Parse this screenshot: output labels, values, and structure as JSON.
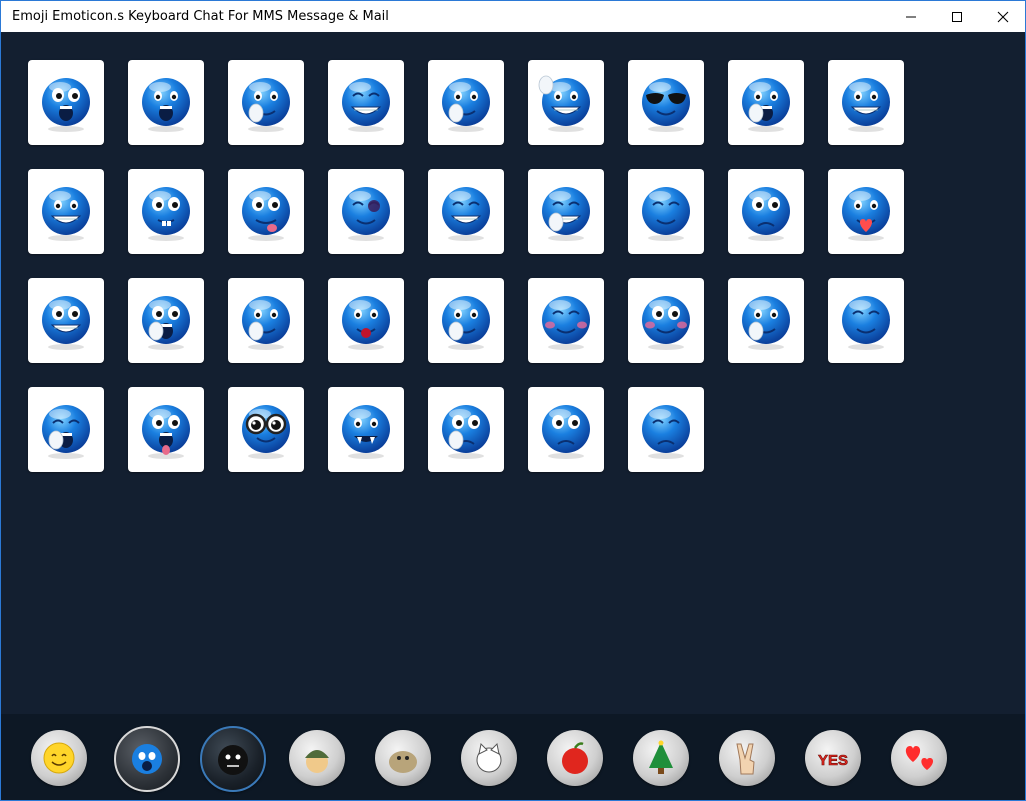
{
  "window": {
    "title": "Emoji Emoticon.s Keyboard Chat For MMS Message & Mail",
    "controls": [
      "minimize-icon",
      "maximize-icon",
      "close-icon"
    ]
  },
  "colors": {
    "background": "#131f30",
    "bottom_bar": "#0d1825",
    "emoticon_blue": "#1a7fe0",
    "tile": "#ffffff"
  },
  "emoticons": [
    [
      "shocked",
      "screaming",
      "hand-wave-face",
      "big-grin",
      "shush",
      "waving-grin",
      "sunglasses",
      "crying-scream",
      "grimace"
    ],
    [
      "angry-grin",
      "buck-teeth",
      "tongue-out-pull",
      "black-eye",
      "teeth-grin",
      "hug",
      "annoyed",
      "worried",
      "heart-in-mouth"
    ],
    [
      "nervous",
      "frightened",
      "praying",
      "rose-in-mouth",
      "hands-over-mouth",
      "blushing",
      "blushing-sparkle",
      "hands-on-face",
      "smirk"
    ],
    [
      "yawning",
      "tongue-out-shocked",
      "big-glasses",
      "vampire",
      "confused",
      "puppy-eyes",
      "sad"
    ]
  ],
  "categories": [
    {
      "name": "yellow-smiley-icon",
      "state": "normal"
    },
    {
      "name": "blue-emoticon-icon",
      "state": "selected"
    },
    {
      "name": "black-emoticon-icon",
      "state": "dark"
    },
    {
      "name": "soldier-icon",
      "state": "normal"
    },
    {
      "name": "sack-creature-icon",
      "state": "normal"
    },
    {
      "name": "cat-icon",
      "state": "normal"
    },
    {
      "name": "apple-icon",
      "state": "normal"
    },
    {
      "name": "christmas-tree-icon",
      "state": "normal"
    },
    {
      "name": "peace-hand-icon",
      "state": "normal"
    },
    {
      "name": "yes-text-icon",
      "state": "normal",
      "label": "YES"
    },
    {
      "name": "hearts-icon",
      "state": "normal"
    }
  ]
}
